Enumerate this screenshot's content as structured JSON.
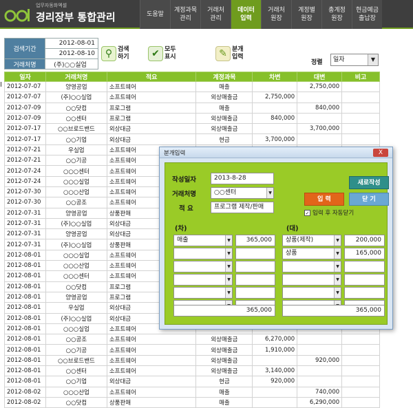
{
  "header": {
    "subtitle": "업무자동화엑셀",
    "title": "경리장부 통합관리",
    "nav": [
      "도움말",
      "계정과목\n관리",
      "거래처\n관리",
      "데이터\n입력",
      "거래처\n원장",
      "계정별\n원장",
      "총계정\n원장",
      "현금예금\n출납장"
    ]
  },
  "filter": {
    "period_label": "검색기간",
    "date_from": "2012-08-01",
    "date_to": "2012-08-10",
    "partner_label": "거래처명",
    "partner_value": "(주)○○실업"
  },
  "toolbar": {
    "search_label": "검색\n하기",
    "show_all_label": "모두\n표시",
    "split_label": "분개\n입력",
    "sort_label": "정렬",
    "sort_value": "일자"
  },
  "table": {
    "headers": [
      "일자",
      "거래처명",
      "적요",
      "계정과목",
      "차변",
      "대변",
      "비고"
    ],
    "rows": [
      [
        "2012-07-07",
        "양영공업",
        "소프트웨어",
        "매출",
        "",
        "2,750,000",
        ""
      ],
      [
        "2012-07-07",
        "(주)○○실업",
        "소프트웨어",
        "외상매출금",
        "2,750,000",
        "",
        ""
      ],
      [
        "2012-07-09",
        "○○닷컴",
        "프로그램",
        "매출",
        "",
        "840,000",
        ""
      ],
      [
        "2012-07-09",
        "○○센터",
        "프로그램",
        "외상매출금",
        "840,000",
        "",
        ""
      ],
      [
        "2012-07-17",
        "○○브로드밴드",
        "외상대금",
        "외상매출금",
        "",
        "3,700,000",
        ""
      ],
      [
        "2012-07-17",
        "○○기업",
        "외상대금",
        "현금",
        "3,700,000",
        "",
        ""
      ],
      [
        "2012-07-21",
        "우실업",
        "소프트웨어",
        "",
        "",
        "",
        ""
      ],
      [
        "2012-07-21",
        "○○기공",
        "소프트웨어",
        "",
        "",
        "",
        ""
      ],
      [
        "2012-07-24",
        "○○○센터",
        "소프트웨어",
        "",
        "",
        "",
        ""
      ],
      [
        "2012-07-24",
        "○○○실업",
        "소프트웨어",
        "",
        "",
        "",
        ""
      ],
      [
        "2012-07-30",
        "○○○산업",
        "소프트웨어",
        "",
        "",
        "",
        ""
      ],
      [
        "2012-07-30",
        "○○공조",
        "소프트웨어",
        "",
        "",
        "",
        ""
      ],
      [
        "2012-07-31",
        "양영공업",
        "상품판매",
        "",
        "",
        "",
        ""
      ],
      [
        "2012-07-31",
        "(주)○○실업",
        "외상대금",
        "",
        "",
        "",
        ""
      ],
      [
        "2012-07-31",
        "양영공업",
        "외상대금",
        "",
        "",
        "",
        ""
      ],
      [
        "2012-07-31",
        "(주)○○실업",
        "상품판매",
        "",
        "",
        "",
        ""
      ],
      [
        "2012-08-01",
        "○○○실업",
        "소프트웨어",
        "",
        "",
        "",
        ""
      ],
      [
        "2012-08-01",
        "○○○산업",
        "소프트웨어",
        "",
        "",
        "",
        ""
      ],
      [
        "2012-08-01",
        "○○○센터",
        "소프트웨어",
        "",
        "",
        "",
        ""
      ],
      [
        "2012-08-01",
        "○○닷컴",
        "프로그램",
        "",
        "",
        "",
        ""
      ],
      [
        "2012-08-01",
        "양영공업",
        "프로그램",
        "",
        "",
        "",
        ""
      ],
      [
        "2012-08-01",
        "우실업",
        "외상대금",
        "",
        "",
        "",
        ""
      ],
      [
        "2012-08-01",
        "(주)○○실업",
        "외상대금",
        "",
        "",
        "",
        ""
      ],
      [
        "2012-08-01",
        "○○○실업",
        "소프트웨어",
        "",
        "",
        "",
        ""
      ],
      [
        "2012-08-01",
        "○○공조",
        "소프트웨어",
        "외상매출금",
        "6,270,000",
        "",
        ""
      ],
      [
        "2012-08-01",
        "○○기공",
        "소프트웨어",
        "외상매출금",
        "1,910,000",
        "",
        ""
      ],
      [
        "2012-08-01",
        "○○브로드밴드",
        "소프트웨어",
        "외상매출금",
        "",
        "920,000",
        ""
      ],
      [
        "2012-08-01",
        "○○센터",
        "소프트웨어",
        "외상매출금",
        "3,140,000",
        "",
        ""
      ],
      [
        "2012-08-01",
        "○○기업",
        "외상대금",
        "현금",
        "920,000",
        "",
        ""
      ],
      [
        "2012-08-02",
        "○○○산업",
        "소프트웨어",
        "매출",
        "",
        "740,000",
        ""
      ],
      [
        "2012-08-02",
        "○○닷컴",
        "상품판매",
        "매출",
        "",
        "6,290,000",
        ""
      ]
    ]
  },
  "dialog": {
    "title": "분개입력",
    "close_label": "X",
    "date_label": "작성일자",
    "date_value": "2013-8-28",
    "partner_label": "거래처명",
    "partner_value": "○○센터",
    "summary_label": "적 요",
    "summary_value": "프로그램 제작/판매",
    "new_button": "새로작성",
    "input_button": "입 력",
    "close_button": "닫 기",
    "auto_close_label": "입력 후 자동닫기",
    "auto_close_checked": "✓",
    "debit_header": "(차)",
    "credit_header": "(대)",
    "debit_rows": [
      {
        "account": "매출",
        "amount": "365,000"
      },
      {
        "account": "",
        "amount": ""
      },
      {
        "account": "",
        "amount": ""
      },
      {
        "account": "",
        "amount": ""
      },
      {
        "account": "",
        "amount": ""
      },
      {
        "account": "",
        "amount": ""
      }
    ],
    "credit_rows": [
      {
        "account": "상품(제작)",
        "amount": "200,000"
      },
      {
        "account": "상품",
        "amount": "165,000"
      },
      {
        "account": "",
        "amount": ""
      },
      {
        "account": "",
        "amount": ""
      },
      {
        "account": "",
        "amount": ""
      },
      {
        "account": "",
        "amount": ""
      }
    ],
    "debit_total": "365,000",
    "credit_total": "365,000"
  },
  "colors": {
    "header_bg": "#3e3e3e",
    "accent_green": "#86c02a",
    "dialog_green": "#9acb27",
    "label_blue": "#4f7fa0"
  }
}
